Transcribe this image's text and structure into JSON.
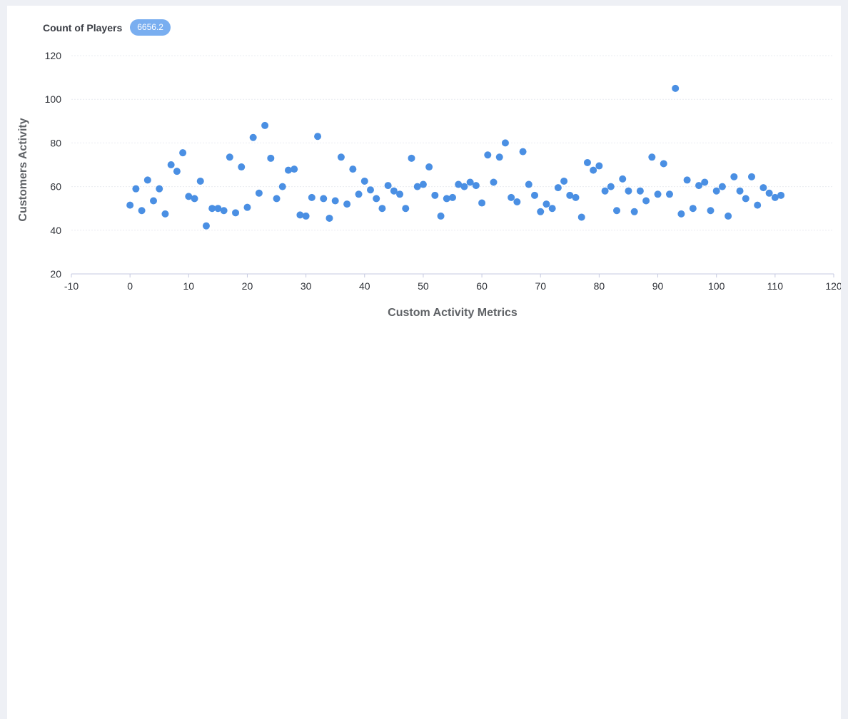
{
  "header": {
    "title": "Count of Players",
    "badge": "6656.2"
  },
  "colors": {
    "point": "#4a8fe3",
    "badge": "#79aef0",
    "grid": "#e9ecf1",
    "axis": "#c5c9e0"
  },
  "chart_data": {
    "type": "scatter",
    "xlabel": "Custom Activity Metrics",
    "ylabel": "Customers Activity",
    "xlim": [
      -10,
      120
    ],
    "ylim": [
      20,
      120
    ],
    "xticks": [
      -10,
      0,
      10,
      20,
      30,
      40,
      50,
      60,
      70,
      80,
      90,
      100,
      110,
      120
    ],
    "yticks": [
      20,
      40,
      60,
      80,
      100,
      120
    ],
    "grid": "horizontal",
    "x": [
      0,
      1,
      2,
      3,
      4,
      5,
      6,
      7,
      8,
      9,
      10,
      11,
      12,
      13,
      14,
      15,
      16,
      17,
      18,
      19,
      20,
      21,
      22,
      23,
      24,
      25,
      26,
      27,
      28,
      29,
      30,
      31,
      32,
      33,
      34,
      35,
      36,
      37,
      38,
      39,
      40,
      41,
      42,
      43,
      44,
      45,
      46,
      47,
      48,
      49,
      50,
      51,
      52,
      53,
      54,
      55,
      56,
      57,
      58,
      59,
      60,
      61,
      62,
      63,
      64,
      65,
      66,
      67,
      68,
      69,
      70,
      71,
      72,
      73,
      74,
      75,
      76,
      77,
      78,
      79,
      80,
      81,
      82,
      83,
      84,
      85,
      86,
      87,
      88,
      89,
      90,
      91,
      92,
      93,
      94,
      95,
      96,
      97,
      98,
      99,
      100,
      101,
      102,
      103,
      104,
      105,
      106,
      107,
      108,
      109,
      110,
      111
    ],
    "y": [
      51.5,
      59,
      49,
      63,
      53.5,
      59,
      47.5,
      70,
      67,
      75.5,
      55.5,
      54.5,
      62.5,
      42,
      50,
      50,
      49,
      73.5,
      48,
      69,
      50.5,
      82.5,
      57,
      88,
      73,
      54.5,
      60,
      67.5,
      68,
      47,
      46.5,
      55,
      83,
      54.5,
      45.5,
      53.5,
      73.5,
      52,
      68,
      56.5,
      62.5,
      58.5,
      54.5,
      50,
      60.5,
      58,
      56.5,
      50,
      73,
      60,
      61,
      69,
      56,
      46.5,
      54.5,
      55,
      61,
      60,
      62,
      60.5,
      52.5,
      74.5,
      62,
      73.5,
      80,
      55,
      53,
      76,
      61,
      56,
      48.5,
      52,
      50,
      59.5,
      62.5,
      56,
      55,
      46,
      71,
      67.5,
      69.5,
      58,
      60,
      49,
      63.5,
      58,
      48.5,
      58,
      53.5,
      73.5,
      56.5,
      70.5,
      56.5,
      105,
      47.5,
      63,
      50,
      60.5,
      62,
      49,
      58,
      60,
      46.5,
      64.5,
      58,
      54.5,
      64.5,
      51.5,
      59.5,
      57,
      55,
      56
    ]
  }
}
